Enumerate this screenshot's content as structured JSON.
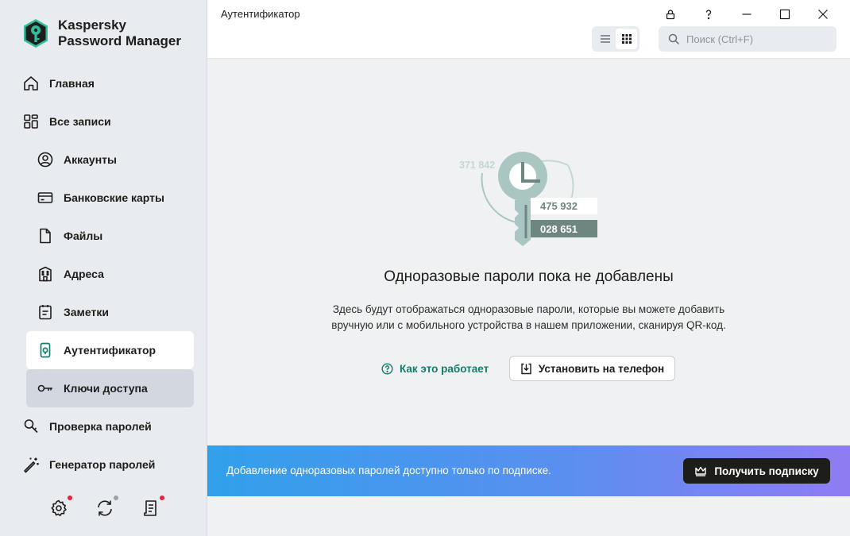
{
  "app": {
    "brand_line1": "Kaspersky",
    "brand_line2": "Password Manager",
    "window_title": "Аутентификатор"
  },
  "sidebar": {
    "items": [
      {
        "label": "Главная",
        "icon": "home-icon"
      },
      {
        "label": "Все записи",
        "icon": "grid-icon"
      },
      {
        "label": "Аккаунты",
        "icon": "user-icon"
      },
      {
        "label": "Банковские карты",
        "icon": "card-icon"
      },
      {
        "label": "Файлы",
        "icon": "file-icon"
      },
      {
        "label": "Адреса",
        "icon": "building-icon"
      },
      {
        "label": "Заметки",
        "icon": "notes-icon"
      },
      {
        "label": "Аутентификатор",
        "icon": "authenticator-icon"
      },
      {
        "label": "Ключи доступа",
        "icon": "key-icon"
      },
      {
        "label": "Проверка паролей",
        "icon": "magnifier-icon"
      },
      {
        "label": "Генератор паролей",
        "icon": "magic-wand-icon"
      }
    ],
    "active_item": "Аутентификатор",
    "bottom_icons": [
      "settings-icon",
      "sync-icon",
      "report-icon"
    ]
  },
  "toolbar": {
    "search_placeholder": "Поиск (Ctrl+F)",
    "view_modes": [
      "list",
      "grid"
    ],
    "active_view": "grid"
  },
  "empty_state": {
    "codes": [
      "371 842",
      "475 932",
      "028 651"
    ],
    "heading": "Одноразовые пароли пока не добавлены",
    "description": "Здесь будут отображаться одноразовые пароли, которые вы можете добавить вручную или с мобильного устройства в нашем приложении, сканируя QR-код.",
    "how_it_works": "Как это работает",
    "install_button": "Установить на телефон"
  },
  "banner": {
    "text": "Добавление одноразовых паролей доступно только по подписке.",
    "button": "Получить подписку"
  },
  "colors": {
    "accent_green": "#117e6b",
    "notification_red": "#e0253f",
    "sidebar_bg": "#e8ebf0"
  }
}
